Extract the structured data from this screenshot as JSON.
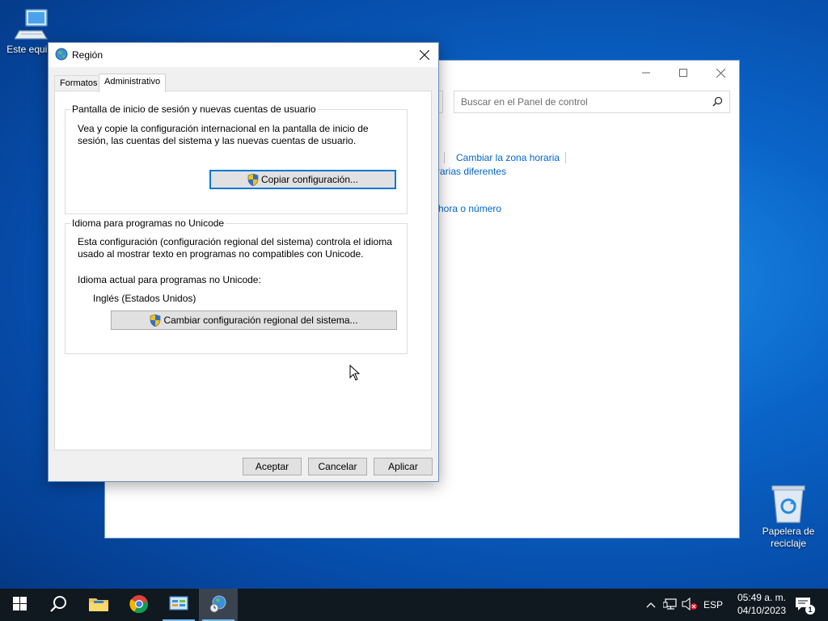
{
  "desktop": {
    "icons": [
      {
        "label": "Este equipo",
        "icon": "computer-icon"
      },
      {
        "label": "Papelera de reciclaje",
        "icon": "recycle-bin-icon"
      }
    ]
  },
  "control_panel": {
    "search_placeholder": "Buscar en el Panel de control",
    "links": {
      "change_timezone": "Cambiar la zona horaria",
      "different_zones": "rarias diferentes",
      "date_time_number": "hora o número"
    }
  },
  "dialog": {
    "title": "Región",
    "close_label": "✕",
    "tabs": [
      {
        "label": "Formatos",
        "active": false
      },
      {
        "label": "Administrativo",
        "active": true
      }
    ],
    "login_group": {
      "title": "Pantalla de inicio de sesión y nuevas cuentas de usuario",
      "line1": "Vea y copie la configuración internacional en la pantalla de inicio de",
      "line2": "sesión, las cuentas del sistema y las nuevas cuentas de usuario.",
      "button": "Copiar configuración..."
    },
    "unicode_group": {
      "title": "Idioma para programas no Unicode",
      "line1": "Esta configuración (configuración regional del sistema) controla el idioma",
      "line2": "usado al mostrar texto en programas no compatibles con Unicode.",
      "current_label": "Idioma actual para programas no Unicode:",
      "current_value": "Inglés (Estados Unidos)",
      "button": "Cambiar configuración regional del sistema..."
    },
    "buttons": {
      "ok": "Aceptar",
      "cancel": "Cancelar",
      "apply": "Aplicar"
    }
  },
  "taskbar": {
    "items": [
      "start-icon",
      "search-icon",
      "file-explorer-icon",
      "chrome-icon",
      "control-panel-icon",
      "region-icon"
    ],
    "language": "ESP",
    "time": "05:49 a. m.",
    "date": "04/10/2023",
    "notification_count": "1"
  },
  "colors": {
    "accent": "#0078d7",
    "link": "#0066cc",
    "taskbar": "#101820"
  }
}
